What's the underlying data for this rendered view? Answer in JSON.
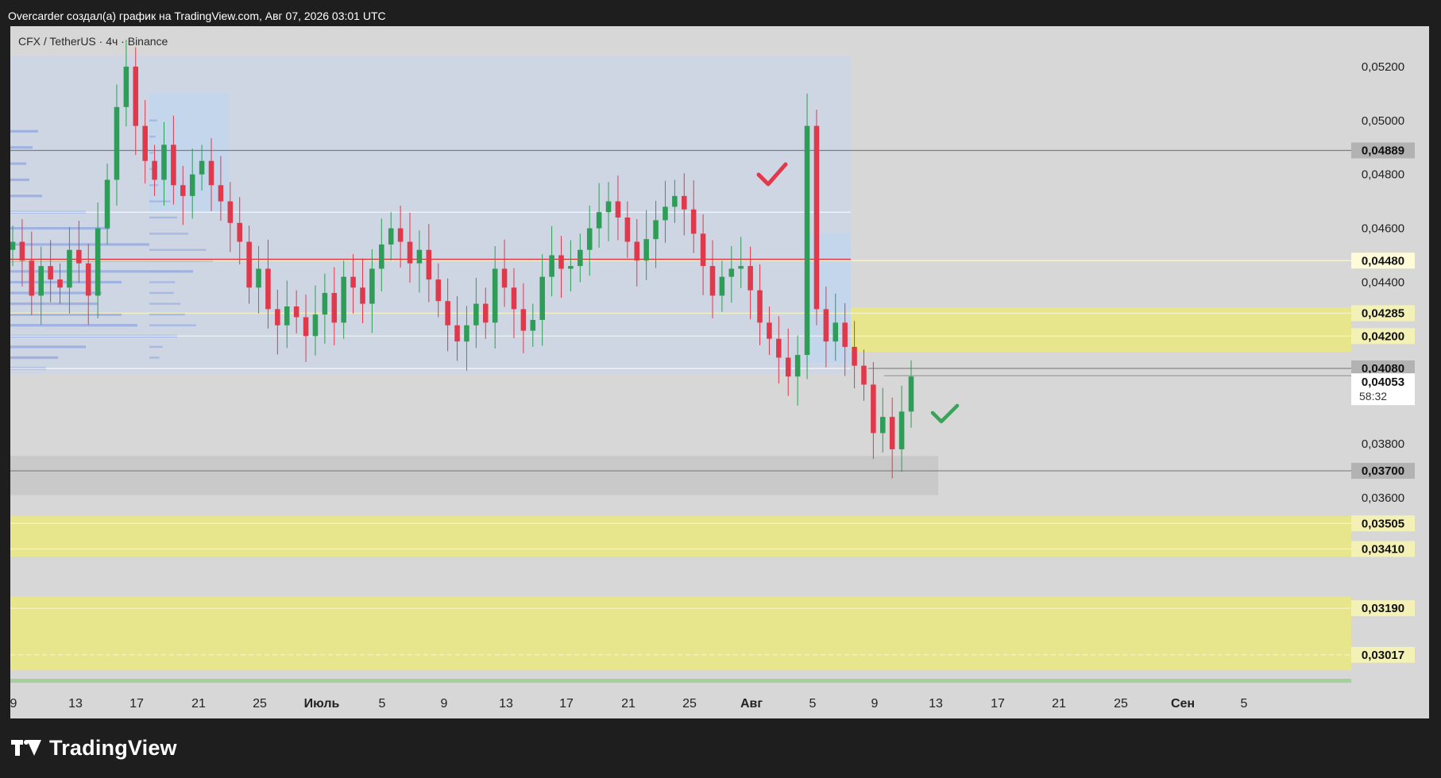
{
  "header": {
    "title": "Overcarder создал(а) график на TradingView.com, Авг 07, 2026 03:01 UTC"
  },
  "footer": {
    "logo_text": "TradingView"
  },
  "chart_data": {
    "type": "candlestick",
    "symbol_label": "CFX / TetherUS · 4ч · Binance",
    "last_price": "0,04053",
    "countdown": "58:32",
    "y_range": [
      0.0289,
      0.0535
    ],
    "y_ticks": [
      {
        "value": 0.052,
        "label": "0,05200"
      },
      {
        "value": 0.05,
        "label": "0,05000"
      },
      {
        "value": 0.048,
        "label": "0,04800"
      },
      {
        "value": 0.046,
        "label": "0,04600"
      },
      {
        "value": 0.044,
        "label": "0,04400"
      },
      {
        "value": 0.038,
        "label": "0,03800"
      },
      {
        "value": 0.036,
        "label": "0,03600"
      }
    ],
    "price_levels": [
      {
        "value": 0.04889,
        "label": "0,04889",
        "style": "gray"
      },
      {
        "value": 0.0448,
        "label": "0,04480",
        "style": "yellow"
      },
      {
        "value": 0.04285,
        "label": "0,04285",
        "style": "yellowbox"
      },
      {
        "value": 0.042,
        "label": "0,04200",
        "style": "yellowbox"
      },
      {
        "value": 0.0408,
        "label": "0,04080",
        "style": "gray"
      },
      {
        "value": 0.037,
        "label": "0,03700",
        "style": "gray"
      },
      {
        "value": 0.03505,
        "label": "0,03505",
        "style": "yellow"
      },
      {
        "value": 0.0341,
        "label": "0,03410",
        "style": "yellow"
      },
      {
        "value": 0.0319,
        "label": "0,03190",
        "style": "yellow"
      },
      {
        "value": 0.03017,
        "label": "0,03017",
        "style": "yellow"
      }
    ],
    "x_ticks": [
      "9",
      "13",
      "17",
      "21",
      "25",
      "Июль",
      "5",
      "9",
      "13",
      "17",
      "21",
      "25",
      "Авг",
      "5",
      "9",
      "13",
      "17",
      "21",
      "25",
      "Сен",
      "5"
    ],
    "colors": {
      "up": "#2e9d57",
      "down": "#e0394b",
      "zone_yellow": "#e8e68d",
      "volume_profile": "#9aaee0",
      "range_box": "#ccd6e6"
    },
    "close_path": [
      0.0455,
      0.0448,
      0.0435,
      0.0446,
      0.0441,
      0.0438,
      0.0452,
      0.0447,
      0.0435,
      0.046,
      0.0478,
      0.0505,
      0.052,
      0.0498,
      0.0485,
      0.0478,
      0.0491,
      0.0476,
      0.0472,
      0.048,
      0.0485,
      0.0476,
      0.047,
      0.0462,
      0.0455,
      0.0438,
      0.0445,
      0.043,
      0.0424,
      0.0431,
      0.0427,
      0.042,
      0.0428,
      0.0436,
      0.0425,
      0.0442,
      0.0438,
      0.0432,
      0.0445,
      0.0454,
      0.046,
      0.0455,
      0.0447,
      0.0452,
      0.0441,
      0.0433,
      0.0424,
      0.0418,
      0.0424,
      0.0432,
      0.0425,
      0.0445,
      0.0438,
      0.043,
      0.0422,
      0.0426,
      0.0442,
      0.045,
      0.0445,
      0.0446,
      0.0452,
      0.046,
      0.0466,
      0.047,
      0.0464,
      0.0455,
      0.0448,
      0.0456,
      0.0463,
      0.0468,
      0.0472,
      0.0467,
      0.0458,
      0.0446,
      0.0435,
      0.0442,
      0.0445,
      0.0446,
      0.0437,
      0.0425,
      0.0419,
      0.0412,
      0.0405,
      0.0413,
      0.0498,
      0.043,
      0.0418,
      0.0425,
      0.0416,
      0.0409,
      0.0402,
      0.0384,
      0.039,
      0.0378,
      0.0392,
      0.0405
    ],
    "annotations": [
      {
        "type": "check",
        "color": "#e0394b",
        "near": "0,04889"
      },
      {
        "type": "check",
        "color": "#3aa35a",
        "near": "0,03700"
      }
    ]
  }
}
